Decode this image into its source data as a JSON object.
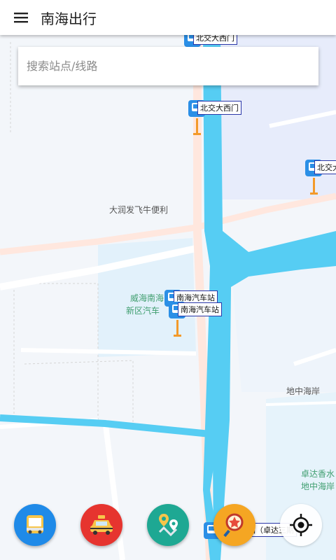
{
  "app": {
    "title": "南海出行"
  },
  "search": {
    "placeholder": "搜索站点/线路"
  },
  "map": {
    "labels": {
      "shop": "大润发飞牛便利",
      "station_area_line1": "威海南海",
      "station_area_line2": "新区汽车",
      "coast": "地中海岸",
      "estate_line1": "卓达香水",
      "estate_line2": "地中海岸"
    },
    "stops": {
      "beijiao_top": "北交大西门",
      "beijiao_mid": "北交大西门",
      "beijiao_right": "北交大",
      "nanhai_1": "南海汽车站",
      "nanhai_2": "南海汽车站",
      "bottom": "站（卓达三期"
    }
  },
  "actions": {
    "bus": "bus-icon",
    "taxi": "taxi-icon",
    "route": "route-map-icon",
    "search_star": "star-search-icon",
    "locate": "crosshair-icon"
  },
  "colors": {
    "water": "#56cdf3",
    "road": "#ffe8dd",
    "pin": "#2b8fe6",
    "pin_stem": "#f39a2a"
  }
}
